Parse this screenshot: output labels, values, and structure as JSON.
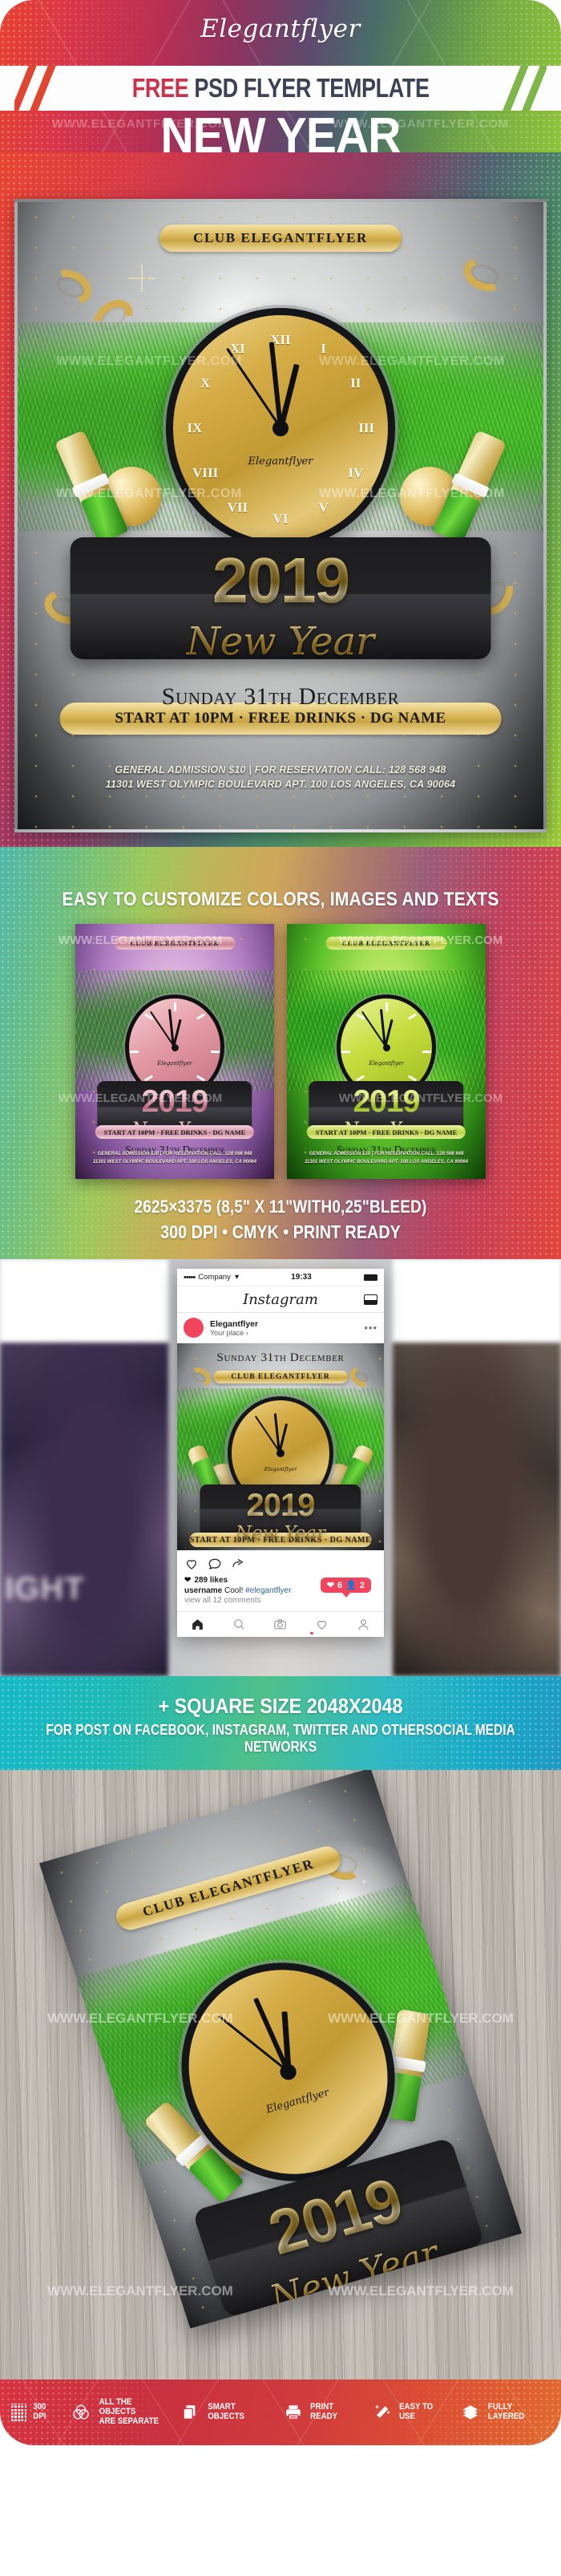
{
  "header": {
    "brand_script": "Elegantflyer",
    "band_free": "FREE",
    "band_rest": " PSD FLYER TEMPLATE",
    "hero_title": "NEW YEAR",
    "watermark": "WWW.ELEGANTFLYER.COM"
  },
  "flyer": {
    "club_pill": "CLUB ELEGANTFLYER",
    "clock_brand": "Elegantflyer",
    "year": "2019",
    "new_year": "New Year",
    "date": "Sunday 31th December",
    "start_pill": "START AT 10PM · FREE DRINKS · DG NAME",
    "addr_line1": "GENERAL ADMISSION $10 | FOR RESERVATION CALL: 128 568 948",
    "addr_line2": "11301 WEST OLYMPIC BOULEVARD APT. 100 LOS ANGELES, CA 90064",
    "roman_numerals": [
      "XII",
      "I",
      "II",
      "III",
      "IV",
      "V",
      "VI",
      "VII",
      "VIII",
      "IX",
      "X",
      "XI"
    ]
  },
  "customize": {
    "heading": "EASY TO CUSTOMIZE COLORS,  IMAGES AND TEXTS",
    "spec_size": "2625×3375 (8,5\" X 11\"WITH0,25\"BLEED)",
    "spec_print": "300 DPI • CMYK • PRINT READY",
    "variants": [
      {
        "name": "pink-variant",
        "color": "#c4707f",
        "club_pill": "CLUB ELEGANTFLYER",
        "year": "2019",
        "new_year": "New Year",
        "date": "Sunday 31th December",
        "start_pill": "START AT 10PM · FREE DRINKS · DG NAME",
        "addr_line1": "GENERAL ADMISSION $10 | FOR RESERVATION CALL: 128 568 948",
        "addr_line2": "11301 WEST OLYMPIC BOULEVARD APT. 100 LOS ANGELES, CA 90064",
        "clock_brand": "Elegantflyer"
      },
      {
        "name": "green-variant",
        "color": "#9cba1e",
        "club_pill": "CLUB ELEGANTFLYER",
        "year": "2019",
        "new_year": "New Year",
        "date": "Sunday 31th December",
        "start_pill": "START AT 10PM · FREE DRINKS · DG NAME",
        "addr_line1": "GENERAL ADMISSION $10 | FOR RESERVATION CALL: 128 568 948",
        "addr_line2": "11301 WEST OLYMPIC BOULEVARD APT. 100 LOS ANGELES, CA 90064",
        "clock_brand": "Elegantflyer"
      }
    ]
  },
  "instagram": {
    "status_dots": "•••••",
    "carrier": "Company",
    "wifi_icon": "wifi-icon",
    "time": "19:33",
    "battery_icon": "battery-icon",
    "logo": "Instagram",
    "inbox_icon": "inbox-icon",
    "username": "Elegantflyer",
    "place": "Your place  ›",
    "more_icon": "•••",
    "post": {
      "date": "Sunday 31th December",
      "club_pill": "CLUB ELEGANTFLYER",
      "clock_brand": "Elegantflyer",
      "year": "2019",
      "new_year": "New Year",
      "start_pill": "START AT 10PM · FREE DRINKS · DG NAME"
    },
    "actions": [
      "heart-icon",
      "comment-icon",
      "share-icon"
    ],
    "likes": "289 likes",
    "comment_user": "username",
    "comment_text": " Cool! ",
    "comment_tag": "#elegantflyer",
    "view_all": "view all 12 comments",
    "notif_likes": "6",
    "notif_follows": "2",
    "tabs": [
      "home-icon",
      "search-icon",
      "camera-icon",
      "activity-icon",
      "profile-icon"
    ]
  },
  "square": {
    "line1": "+ SQUARE SIZE 2048X2048",
    "line2": "FOR POST ON FACEBOOK, INSTAGRAM, TWITTER AND OTHERSOCIAL MEDIA NETWORKS"
  },
  "mockup": {
    "club_pill": "CLUB ELEGANTFLYER",
    "clock_brand": "Elegantflyer",
    "year": "2019",
    "new_year": "New Year",
    "watermark": "WWW.ELEGANTFLYER.COM"
  },
  "footer": {
    "items": [
      {
        "icon": "grid-dpi-icon",
        "label": "300 DPI"
      },
      {
        "icon": "venn-circles-icon",
        "label": "ALL THE OBJECTS\nARE SEPARATE"
      },
      {
        "icon": "documents-icon",
        "label": "SMART OBJECTS"
      },
      {
        "icon": "printer-icon",
        "label": "PRINT READY"
      },
      {
        "icon": "magic-wand-icon",
        "label": "EASY TO USE"
      },
      {
        "icon": "layers-icon",
        "label": "FULLY LAYERED"
      }
    ]
  },
  "colors": {
    "accent_red": "#c9324a",
    "dark_navy": "#3c4253",
    "gold": "#d4ab44",
    "instagram_red": "#f0455c",
    "teal": "#16b8c8"
  }
}
